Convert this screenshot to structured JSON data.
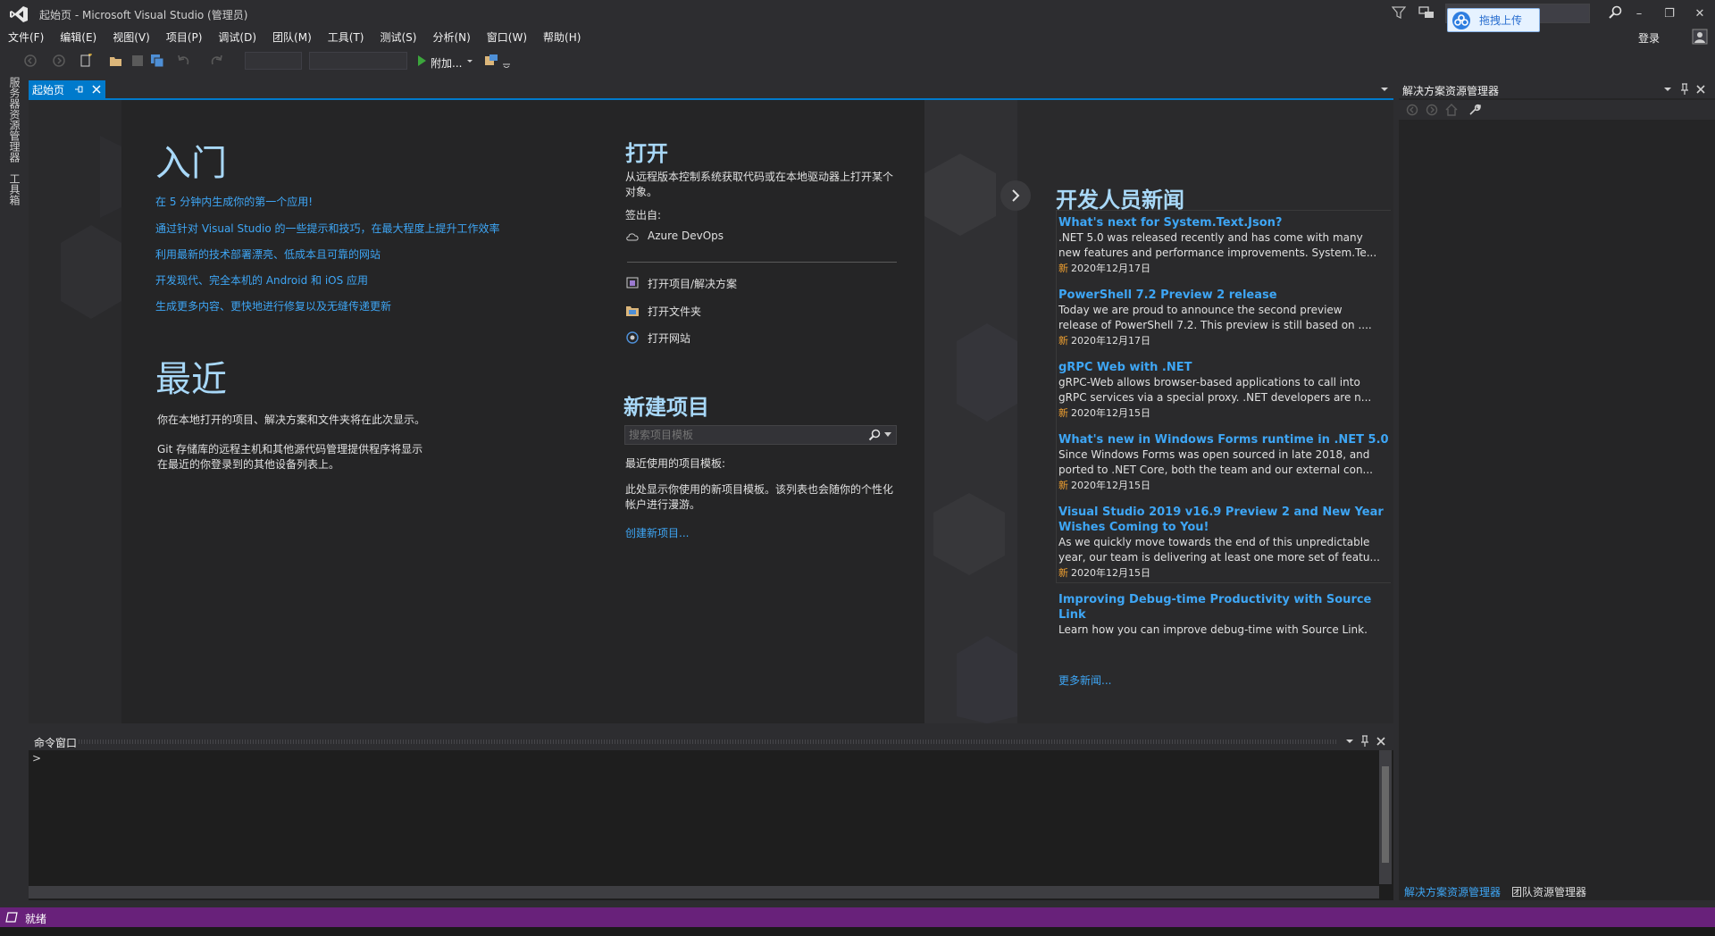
{
  "window": {
    "title": "起始页 - Microsoft Visual Studio (管理员)",
    "minimize": "–",
    "restore": "❐",
    "close": "✕"
  },
  "upload": {
    "label": "拖拽上传"
  },
  "menu": [
    "文件(F)",
    "编辑(E)",
    "视图(V)",
    "项目(P)",
    "调试(D)",
    "团队(M)",
    "工具(T)",
    "测试(S)",
    "分析(N)",
    "窗口(W)",
    "帮助(H)"
  ],
  "account": {
    "login": "登录"
  },
  "toolbar": {
    "attach_label": "附加..."
  },
  "left_rail": {
    "server_explorer": "服务器资源管理器",
    "toolbox": "工具箱"
  },
  "doc_tab": {
    "label": "起始页"
  },
  "start_page": {
    "getting_started": {
      "heading": "入门",
      "links": [
        "在 5 分钟内生成你的第一个应用!",
        "通过针对 Visual Studio 的一些提示和技巧，在最大程度上提升工作效率",
        "利用最新的技术部署漂亮、低成本且可靠的网站",
        "开发现代、完全本机的 Android 和 iOS 应用",
        "生成更多内容、更快地进行修复以及无缝传递更新"
      ]
    },
    "recent": {
      "heading": "最近",
      "text1": "你在本地打开的项目、解决方案和文件夹将在此次显示。",
      "text2_line1": "Git 存储库的远程主机和其他源代码管理提供程序将显示",
      "text2_line2": "在最近的你登录到的其他设备列表上。"
    },
    "open": {
      "heading": "打开",
      "desc_line1": "从远程版本控制系统获取代码或在本地驱动器上打开某个",
      "desc_line2": "对象。",
      "checkout_label": "签出自:",
      "azure": "Azure DevOps",
      "open_project": "打开项目/解决方案",
      "open_folder": "打开文件夹",
      "open_website": "打开网站"
    },
    "new_project": {
      "heading": "新建项目",
      "search_placeholder": "搜索项目模板",
      "recent_label": "最近使用的项目模板:",
      "desc_line1": "此处显示你使用的新项目模板。该列表也会随你的个性化",
      "desc_line2": "帐户进行漫游。",
      "create_link": "创建新项目..."
    },
    "news": {
      "heading": "开发人员新闻",
      "new_badge": "新",
      "items": [
        {
          "title": "What's next for System.Text.Json?",
          "body1": ".NET 5.0 was released recently and has come with many",
          "body2": "new features and performance improvements. System.Te...",
          "date": "2020年12月17日"
        },
        {
          "title": "PowerShell 7.2 Preview 2 release",
          "body1": "Today we are proud to announce the second preview",
          "body2": "release of PowerShell 7.2. This preview is still based on ....",
          "date": "2020年12月17日"
        },
        {
          "title": "gRPC Web with .NET",
          "body1": "gRPC-Web allows browser-based applications to call into",
          "body2": "gRPC services via a special proxy. .NET developers are n...",
          "date": "2020年12月15日"
        },
        {
          "title": "What's new in Windows Forms runtime in .NET 5.0",
          "body1": "Since Windows Forms was open sourced in late 2018, and",
          "body2": "ported to .NET Core, both the team and our external con...",
          "date": "2020年12月15日"
        },
        {
          "title1": "Visual Studio 2019 v16.9 Preview 2 and New Year",
          "title2": "Wishes Coming to You!",
          "body1": "As we quickly move towards the end of this unpredictable",
          "body2": "year, our team is delivering at least one more set of featu...",
          "date": "2020年12月15日"
        },
        {
          "title1": "Improving Debug-time Productivity with Source",
          "title2": "Link",
          "body1": "Learn how you can improve debug-time with Source Link."
        }
      ],
      "more": "更多新闻..."
    }
  },
  "command_window": {
    "title": "命令窗口",
    "prompt": ">"
  },
  "solution_explorer": {
    "title": "解决方案资源管理器",
    "tab_solution": "解决方案资源管理器",
    "tab_team": "团队资源管理器"
  },
  "status": {
    "text": "就绪"
  }
}
